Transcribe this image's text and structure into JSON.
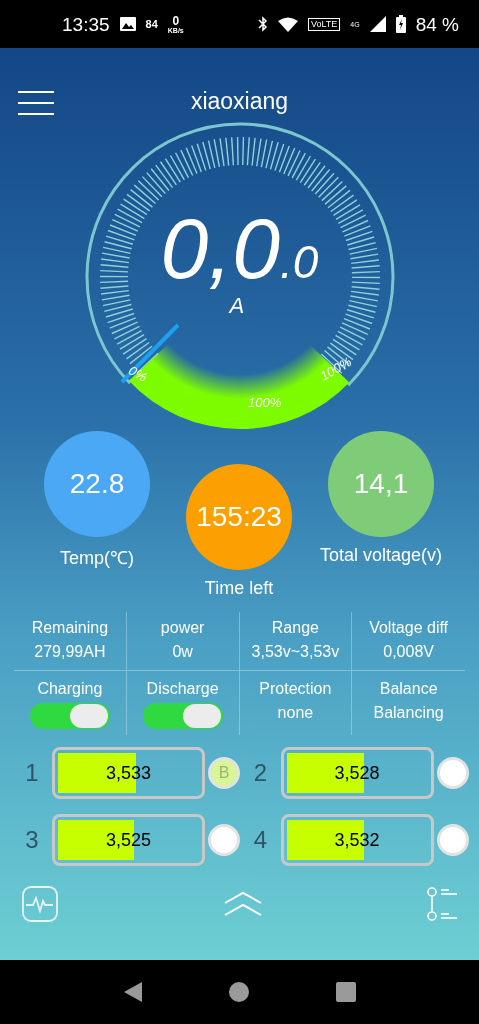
{
  "status_bar": {
    "time": "13:35",
    "notification_count": "84",
    "speed_value": "0",
    "speed_unit": "KB/s",
    "network": "VoLTE",
    "signal_type": "4G",
    "battery": "84 %"
  },
  "header": {
    "title": "xiaoxiang"
  },
  "gauge": {
    "integer": "0,0",
    "decimal": ".0",
    "unit": "A",
    "labels": [
      "0%",
      "100%",
      "100%"
    ]
  },
  "indicators": [
    {
      "value": "22.8",
      "label": "Temp(℃)",
      "color": "#4aa8f5"
    },
    {
      "value": "155:23",
      "label": "Time left",
      "color": "#fba000"
    },
    {
      "value": "14,1",
      "label": "Total voltage(v)",
      "color": "#7ecb78"
    }
  ],
  "stats": [
    {
      "label": "Remaining",
      "value": "279,99AH"
    },
    {
      "label": "power",
      "value": "0w"
    },
    {
      "label": "Range",
      "value": "3,53v~3,53v"
    },
    {
      "label": "Voltage diff",
      "value": "0,008V"
    }
  ],
  "controls": [
    {
      "kind": "switch",
      "label": "Charging",
      "on": true
    },
    {
      "kind": "switch",
      "label": "Discharge",
      "on": true
    },
    {
      "kind": "text",
      "label": "Protection",
      "value": "none"
    },
    {
      "kind": "text",
      "label": "Balance",
      "value": "Balancing"
    }
  ],
  "cells": [
    {
      "number": "1",
      "voltage": "3,533",
      "level": 0.55,
      "balancing": true,
      "badge": "B"
    },
    {
      "number": "2",
      "voltage": "3,528",
      "level": 0.55,
      "balancing": false
    },
    {
      "number": "3",
      "voltage": "3,525",
      "level": 0.54,
      "balancing": false
    },
    {
      "number": "4",
      "voltage": "3,532",
      "level": 0.55,
      "balancing": false
    }
  ]
}
